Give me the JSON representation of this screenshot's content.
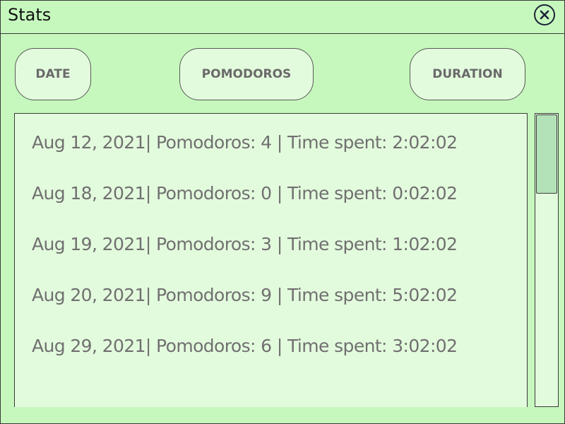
{
  "window": {
    "title": "Stats",
    "close_icon": "close-circle-icon"
  },
  "sort_buttons": {
    "date_label": "DATE",
    "pomodoros_label": "POMODOROS",
    "duration_label": "DURATION"
  },
  "stats_list": [
    "Aug 12, 2021| Pomodoros: 4 | Time spent: 2:02:02",
    "Aug 18, 2021| Pomodoros: 0 | Time spent: 0:02:02",
    "Aug 19, 2021| Pomodoros: 3 | Time spent: 1:02:02",
    "Aug 20, 2021| Pomodoros: 9 | Time spent: 5:02:02",
    "Aug 29, 2021| Pomodoros: 6 | Time spent: 3:02:02"
  ],
  "colors": {
    "background": "#c6f8bd",
    "panel": "#e3fbdd",
    "text_muted": "#707070",
    "border": "#3a3a3a",
    "scroll_thumb": "#b4e2b8"
  }
}
